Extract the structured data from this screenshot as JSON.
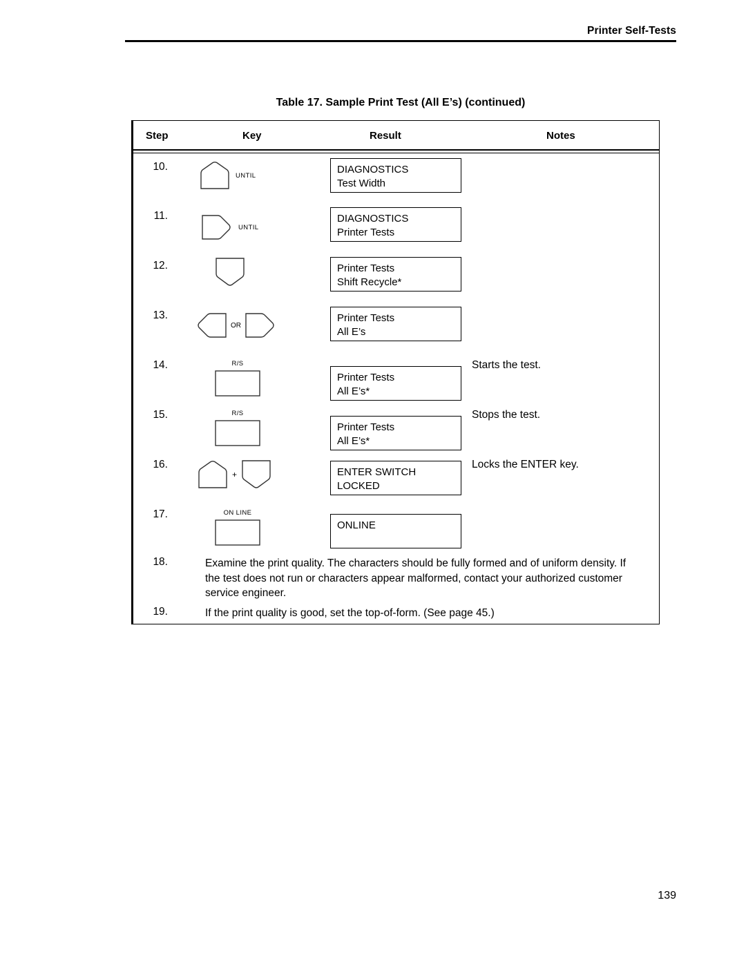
{
  "document": {
    "running_header": "Printer Self-Tests",
    "page_number": "139"
  },
  "table": {
    "caption": "Table 17. Sample Print Test (All E’s) (continued)",
    "columns": [
      "Step",
      "Key",
      "Result",
      "Notes"
    ],
    "rows": [
      {
        "step": "10.",
        "keys": [
          {
            "icon": "key-up-arrow",
            "caption": "UNTIL",
            "caption_pos": "right"
          }
        ],
        "result": [
          "DIAGNOSTICS",
          "Test Width"
        ],
        "note": ""
      },
      {
        "step": "11.",
        "keys": [
          {
            "icon": "key-right-arrow",
            "caption": "UNTIL",
            "caption_pos": "right"
          }
        ],
        "result": [
          "DIAGNOSTICS",
          "Printer Tests"
        ],
        "note": ""
      },
      {
        "step": "12.",
        "keys": [
          {
            "icon": "key-down-arrow",
            "caption": "",
            "caption_pos": "none"
          }
        ],
        "result": [
          "Printer Tests",
          "Shift Recycle*"
        ],
        "note": ""
      },
      {
        "step": "13.",
        "keys": [
          {
            "icon": "key-left-arrow",
            "caption": "",
            "caption_pos": "none"
          },
          {
            "separator": "OR"
          },
          {
            "icon": "key-right-arrow",
            "caption": "",
            "caption_pos": "none"
          }
        ],
        "result": [
          "Printer Tests",
          "All E’s"
        ],
        "note": "Starts the test."
      },
      {
        "step": "14.",
        "keys": [
          {
            "icon": "key-rectangle",
            "caption": "R/S",
            "caption_pos": "top"
          }
        ],
        "result": [
          "Printer Tests",
          "All E’s*"
        ],
        "note": "Starts the test."
      },
      {
        "step": "15.",
        "keys": [
          {
            "icon": "key-rectangle",
            "caption": "R/S",
            "caption_pos": "top"
          }
        ],
        "result": [
          "Printer Tests",
          "All E’s*"
        ],
        "note": "Stops the test."
      },
      {
        "step": "16.",
        "keys": [
          {
            "icon": "key-up-arrow",
            "caption": "",
            "caption_pos": "none"
          },
          {
            "separator": "+"
          },
          {
            "icon": "key-down-arrow",
            "caption": "",
            "caption_pos": "none"
          }
        ],
        "result": [
          "ENTER SWITCH",
          "LOCKED"
        ],
        "note": "Locks the ENTER key."
      },
      {
        "step": "17.",
        "keys": [
          {
            "icon": "key-rectangle",
            "caption": "ON LINE",
            "caption_pos": "top"
          }
        ],
        "result": [
          "ONLINE",
          ""
        ],
        "note": ""
      }
    ],
    "paragraph_rows": [
      {
        "step": "18.",
        "text": "Examine the print quality. The characters should be fully formed and of uniform density. If the test does not run or characters appear malformed, contact your authorized customer service engineer."
      },
      {
        "step": "19.",
        "text": "If the print quality is good, set the top-of-form. (See page 45.)"
      }
    ]
  },
  "row_notes": {
    "r14": "Starts the test.",
    "r15": "Stops the test.",
    "r16": "Locks the ENTER key."
  }
}
